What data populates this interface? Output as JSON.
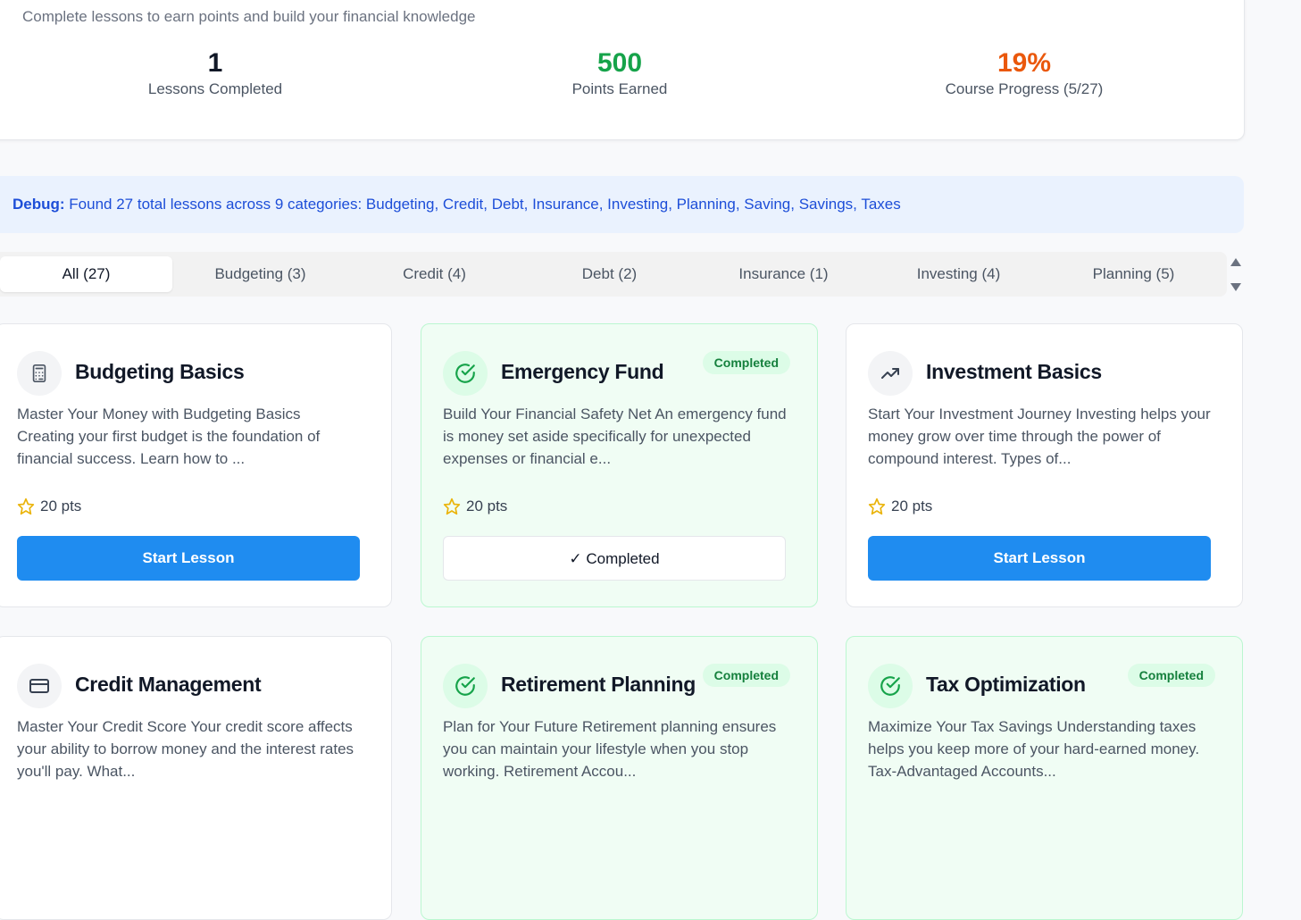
{
  "header": {
    "subtitle": "Complete lessons to earn points and build your financial knowledge"
  },
  "stats": [
    {
      "value": "1",
      "label": "Lessons Completed",
      "color": "#111827"
    },
    {
      "value": "500",
      "label": "Points Earned",
      "color": "#16a34a"
    },
    {
      "value": "19%",
      "label": "Course Progress (5/27)",
      "color": "#ea580c"
    }
  ],
  "debug": {
    "prefix": "Debug:",
    "text": "Found 27 total lessons across 9 categories: Budgeting, Credit, Debt, Insurance, Investing, Planning, Saving, Savings, Taxes"
  },
  "tabs": [
    {
      "label": "All (27)",
      "active": true
    },
    {
      "label": "Budgeting (3)"
    },
    {
      "label": "Credit (4)"
    },
    {
      "label": "Debt (2)"
    },
    {
      "label": "Insurance (1)"
    },
    {
      "label": "Investing (4)"
    },
    {
      "label": "Planning (5)"
    }
  ],
  "lessons": [
    {
      "title": "Budgeting Basics",
      "icon": "calculator-icon",
      "completed": false,
      "description": "Master Your Money with Budgeting Basics Creating your first budget is the foundation of financial success. Learn how to ...",
      "points": "20 pts",
      "button": "Start Lesson"
    },
    {
      "title": "Emergency Fund",
      "icon": "check-circle-icon",
      "completed": true,
      "badge": "Completed",
      "description": "Build Your Financial Safety Net An emergency fund is money set aside specifically for unexpected expenses or financial e...",
      "points": "20 pts",
      "button": "✓ Completed"
    },
    {
      "title": "Investment Basics",
      "icon": "trending-up-icon",
      "completed": false,
      "description": "Start Your Investment Journey Investing helps your money grow over time through the power of compound interest. Types of...",
      "points": "20 pts",
      "button": "Start Lesson"
    },
    {
      "title": "Credit Management",
      "icon": "credit-card-icon",
      "completed": false,
      "description": "Master Your Credit Score Your credit score affects your ability to borrow money and the interest rates you'll pay. What..."
    },
    {
      "title": "Retirement Planning",
      "icon": "check-circle-icon",
      "completed": true,
      "badge": "Completed",
      "description": "Plan for Your Future Retirement planning ensures you can maintain your lifestyle when you stop working. Retirement Accou..."
    },
    {
      "title": "Tax Optimization",
      "icon": "check-circle-icon",
      "completed": true,
      "badge": "Completed",
      "description": "Maximize Your Tax Savings Understanding taxes helps you keep more of your hard-earned money. Tax-Advantaged Accounts..."
    }
  ],
  "colors": {
    "primary": "#1f8cf0",
    "success": "#16a34a",
    "warning": "#ea580c",
    "star": "#eab308"
  }
}
